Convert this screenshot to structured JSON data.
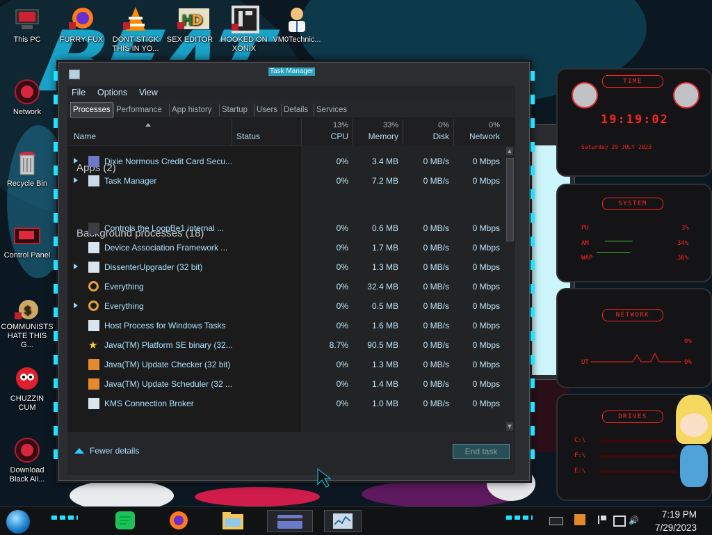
{
  "desktop": {
    "icons": [
      {
        "label": "This PC"
      },
      {
        "label": "FURRY FUX"
      },
      {
        "label": "DONT STICK THIS IN YO..."
      },
      {
        "label": "SEX EDITOR"
      },
      {
        "label": "HOOKED ON XONIX"
      },
      {
        "label": "VM0Technic..."
      },
      {
        "label": "Network"
      },
      {
        "label": "Recycle Bin"
      },
      {
        "label": "Control Panel"
      },
      {
        "label": "COMMUNISTS HATE THIS G..."
      },
      {
        "label": "CHUZZIN CUM"
      },
      {
        "label": "Download Black Ali..."
      }
    ]
  },
  "task_manager": {
    "title": "Task Manager",
    "menu": [
      "File",
      "Options",
      "View"
    ],
    "tabs": [
      "Processes",
      "Performance",
      "App history",
      "Startup",
      "Users",
      "Details",
      "Services"
    ],
    "active_tab": "Processes",
    "header": {
      "name": "Name",
      "status": "Status",
      "cpu_pct": "13%",
      "cpu": "CPU",
      "memory_pct": "33%",
      "memory": "Memory",
      "disk_pct": "0%",
      "disk": "Disk",
      "network_pct": "0%",
      "network": "Network"
    },
    "groups": [
      {
        "label": "Apps (2)"
      },
      {
        "label": "Background processes (18)"
      }
    ],
    "rows": [
      {
        "name": "Dixie Normous Credit Card Secu...",
        "cpu": "0%",
        "memory": "3.4 MB",
        "disk": "0 MB/s",
        "network": "0 Mbps",
        "expandable": true,
        "icon": "card-icon"
      },
      {
        "name": "Task Manager",
        "cpu": "0%",
        "memory": "7.2 MB",
        "disk": "0 MB/s",
        "network": "0 Mbps",
        "expandable": true,
        "icon": "taskmanager-icon"
      },
      {
        "name": "Controls the LoopBe1 internal ...",
        "cpu": "0%",
        "memory": "0.6 MB",
        "disk": "0 MB/s",
        "network": "0 Mbps",
        "expandable": false,
        "icon": "loopbe-icon"
      },
      {
        "name": "Device Association Framework ...",
        "cpu": "0%",
        "memory": "1.7 MB",
        "disk": "0 MB/s",
        "network": "0 Mbps",
        "expandable": false,
        "icon": "window-icon"
      },
      {
        "name": "DissenterUpgrader (32 bit)",
        "cpu": "0%",
        "memory": "1.3 MB",
        "disk": "0 MB/s",
        "network": "0 Mbps",
        "expandable": true,
        "icon": "window-icon"
      },
      {
        "name": "Everything",
        "cpu": "0%",
        "memory": "32.4 MB",
        "disk": "0 MB/s",
        "network": "0 Mbps",
        "expandable": false,
        "icon": "magnifier-icon"
      },
      {
        "name": "Everything",
        "cpu": "0%",
        "memory": "0.5 MB",
        "disk": "0 MB/s",
        "network": "0 Mbps",
        "expandable": true,
        "icon": "magnifier-icon"
      },
      {
        "name": "Host Process for Windows Tasks",
        "cpu": "0%",
        "memory": "1.6 MB",
        "disk": "0 MB/s",
        "network": "0 Mbps",
        "expandable": false,
        "icon": "window-icon"
      },
      {
        "name": "Java(TM) Platform SE binary (32...",
        "cpu": "8.7%",
        "memory": "90.5 MB",
        "disk": "0 MB/s",
        "network": "0 Mbps",
        "expandable": false,
        "icon": "java-star-icon"
      },
      {
        "name": "Java(TM) Update Checker (32 bit)",
        "cpu": "0%",
        "memory": "1.3 MB",
        "disk": "0 MB/s",
        "network": "0 Mbps",
        "expandable": false,
        "icon": "java-icon"
      },
      {
        "name": "Java(TM) Update Scheduler (32 ...",
        "cpu": "0%",
        "memory": "1.4 MB",
        "disk": "0 MB/s",
        "network": "0 Mbps",
        "expandable": false,
        "icon": "java-icon"
      },
      {
        "name": "KMS Connection Broker",
        "cpu": "0%",
        "memory": "1.0 MB",
        "disk": "0 MB/s",
        "network": "0 Mbps",
        "expandable": false,
        "icon": "window-icon"
      }
    ],
    "footer": {
      "fewer_details": "Fewer details",
      "end_task": "End task"
    }
  },
  "widgets": {
    "time": {
      "title": "TIME",
      "clock": "19:19:02",
      "date": "Saturday 29 JULY 2023"
    },
    "system": {
      "title": "SYSTEM",
      "rows": [
        {
          "label": "PU",
          "value": "3%"
        },
        {
          "label": "AM",
          "value": "34%"
        },
        {
          "label": "WAP",
          "value": "36%"
        }
      ]
    },
    "network": {
      "title": "NETWORK",
      "rows": [
        {
          "label": "",
          "value": "0%"
        },
        {
          "label": "UT",
          "value": "0%"
        }
      ]
    },
    "drives": {
      "title": "DRIVES",
      "rows": [
        {
          "label": "C:\\"
        },
        {
          "label": "F:\\"
        },
        {
          "label": "E:\\"
        }
      ]
    }
  },
  "taskbar": {
    "time": "7:19 PM",
    "date": "7/29/2023"
  },
  "colors": {
    "accent_cyan": "#21e3ff",
    "widget_red": "#ff2222",
    "row_text": "#a9e2ff"
  }
}
